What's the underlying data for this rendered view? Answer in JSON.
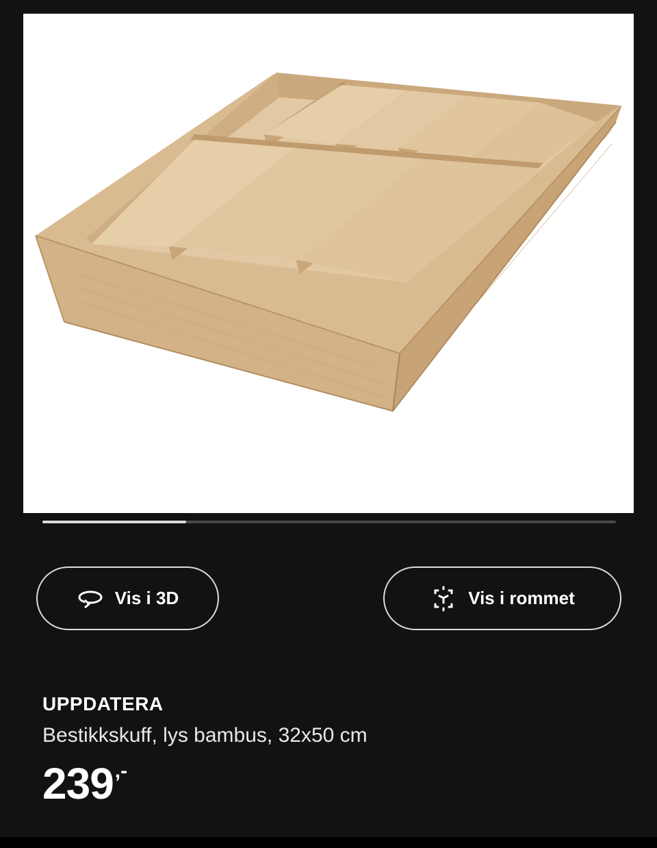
{
  "product": {
    "name": "UPPDATERA",
    "description": "Bestikkskuff, lys bambus, 32x50 cm",
    "price": "239",
    "price_suffix": ",-"
  },
  "gallery": {
    "progress_fraction": 0.25
  },
  "actions": {
    "view_3d_label": "Vis i 3D",
    "view_room_label": "Vis i rommet"
  },
  "icons": {
    "view_3d": "rotate-3d-icon",
    "view_room": "ar-cube-icon"
  },
  "colors": {
    "background": "#121212",
    "wood": "#d8b98f"
  }
}
